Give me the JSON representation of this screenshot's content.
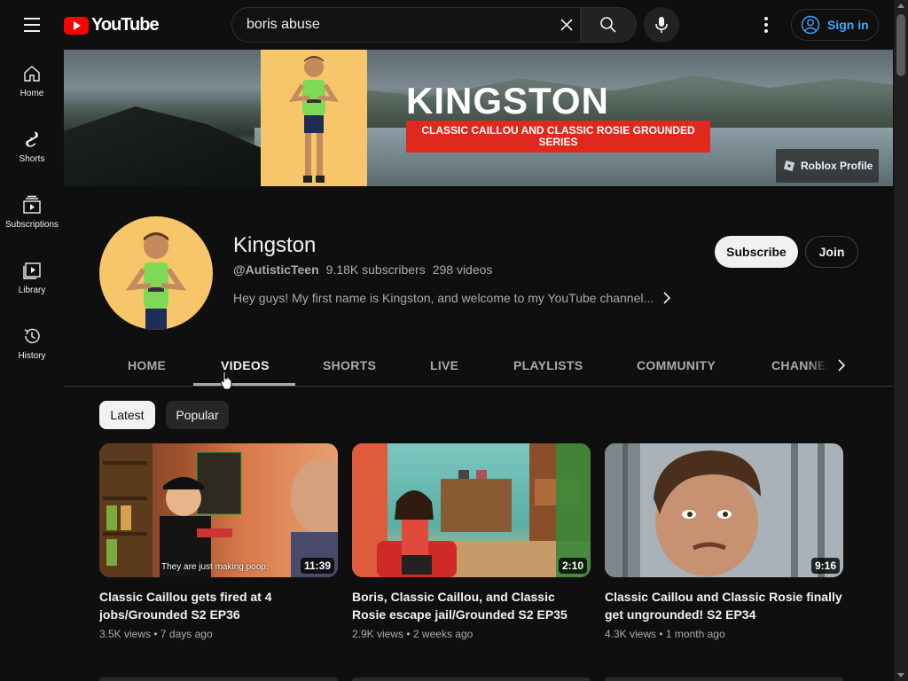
{
  "header": {
    "logo_text": "YouTube",
    "search_value": "boris abuse",
    "signin_label": "Sign in"
  },
  "guide": [
    {
      "label": "Home",
      "icon": "home-icon"
    },
    {
      "label": "Shorts",
      "icon": "shorts-icon"
    },
    {
      "label": "Subscriptions",
      "icon": "subscriptions-icon"
    },
    {
      "label": "Library",
      "icon": "library-icon"
    },
    {
      "label": "History",
      "icon": "history-icon"
    }
  ],
  "banner": {
    "title": "KINGSTON",
    "subtitle": "CLASSIC CAILLOU AND CLASSIC ROSIE GROUNDED SERIES",
    "link_label": "Roblox Profile"
  },
  "channel": {
    "name": "Kingston",
    "handle": "@AutisticTeen",
    "subscribers": "9.18K subscribers",
    "videos_count": "298 videos",
    "description": "Hey guys! My first name is Kingston, and welcome to my YouTube channel...",
    "subscribe_label": "Subscribe",
    "join_label": "Join"
  },
  "tabs": [
    {
      "label": "HOME",
      "active": false
    },
    {
      "label": "VIDEOS",
      "active": true
    },
    {
      "label": "SHORTS",
      "active": false
    },
    {
      "label": "LIVE",
      "active": false
    },
    {
      "label": "PLAYLISTS",
      "active": false
    },
    {
      "label": "COMMUNITY",
      "active": false
    },
    {
      "label": "CHANNELS",
      "active": false
    }
  ],
  "chips": [
    {
      "label": "Latest",
      "selected": true
    },
    {
      "label": "Popular",
      "selected": false
    }
  ],
  "videos": [
    {
      "title": "Classic Caillou gets fired at 4 jobs/Grounded S2 EP36",
      "duration": "11:39",
      "views": "3.5K views",
      "age": "7 days ago",
      "caption": "They are just making poop."
    },
    {
      "title": "Boris, Classic Caillou, and Classic Rosie escape jail/Grounded S2 EP35",
      "duration": "2:10",
      "views": "2.9K views",
      "age": "2 weeks ago"
    },
    {
      "title": "Classic Caillou and Classic Rosie finally get ungrounded! S2 EP34",
      "duration": "9:16",
      "views": "4.3K views",
      "age": "1 month ago"
    }
  ],
  "colors": {
    "background": "#0f0f0f",
    "brand_red": "#ff0000",
    "link_blue": "#3ea6ff",
    "text_secondary": "#aaaaaa",
    "banner_red": "#e0281c"
  }
}
